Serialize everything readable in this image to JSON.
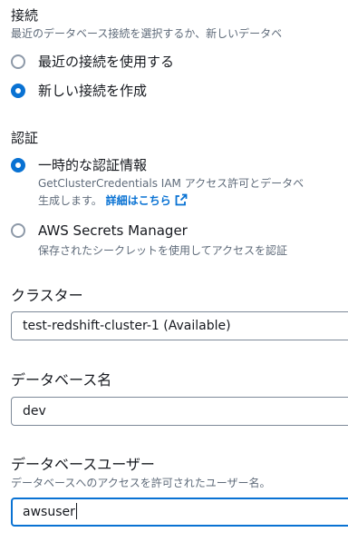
{
  "connection": {
    "title": "接続",
    "description": "最近のデータベース接続を選択するか、新しいデータベ",
    "options": [
      {
        "label": "最近の接続を使用する",
        "selected": false
      },
      {
        "label": "新しい接続を作成",
        "selected": true
      }
    ]
  },
  "auth": {
    "title": "認証",
    "options": [
      {
        "label": "一時的な認証情報",
        "selected": true,
        "description_line1": "GetClusterCredentials IAM アクセス許可とデータベ",
        "description_line2": "生成します。",
        "link": "詳細はこちら",
        "link_icon": "external-link-icon"
      },
      {
        "label": "AWS Secrets Manager",
        "selected": false,
        "description_line1": "保存されたシークレットを使用してアクセスを認証"
      }
    ]
  },
  "cluster": {
    "label": "クラスター",
    "value": "test-redshift-cluster-1 (Available)"
  },
  "database_name": {
    "label": "データベース名",
    "value": "dev"
  },
  "database_user": {
    "label": "データベースユーザー",
    "description": "データベースへのアクセスを許可されたユーザー名。",
    "value": "awsuser"
  },
  "colors": {
    "accent": "#0972d3",
    "text": "#16191f",
    "secondary_text": "#5f6b7a",
    "border": "#7d8998"
  }
}
